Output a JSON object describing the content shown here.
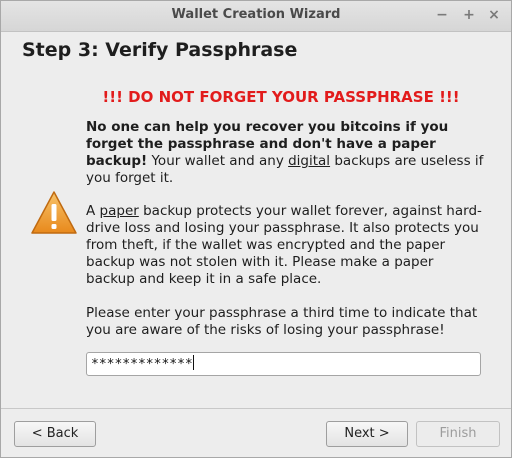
{
  "window": {
    "title": "Wallet Creation Wizard",
    "controls": {
      "minimize": "−",
      "maximize": "+",
      "close": "×"
    }
  },
  "step_title": "Step 3: Verify Passphrase",
  "warning_title": "!!! DO NOT FORGET YOUR PASSPHRASE !!!",
  "paragraph1": {
    "bold": "No one can help you recover you bitcoins if you forget the passphrase and don't have a paper backup!",
    "text_before": " Your wallet and any ",
    "link": "digital",
    "text_after": " backups are useless if you forget it."
  },
  "paragraph2": {
    "text_before": "A ",
    "link": "paper",
    "text_after": " backup protects your wallet forever, against hard-drive loss and losing your passphrase. It also protects you from theft, if the wallet was encrypted and the paper backup was not stolen with it. Please make a paper backup and keep it in a safe place."
  },
  "paragraph3": "Please enter your passphrase a third time to indicate that you are aware of the risks of losing your passphrase!",
  "passphrase_input": {
    "value": "*************"
  },
  "buttons": {
    "back": "< Back",
    "next": "Next >",
    "finish": "Finish"
  },
  "icon": "warning-triangle-icon",
  "colors": {
    "warning_text": "#e21b1b",
    "warning_icon": "#f0a030"
  }
}
